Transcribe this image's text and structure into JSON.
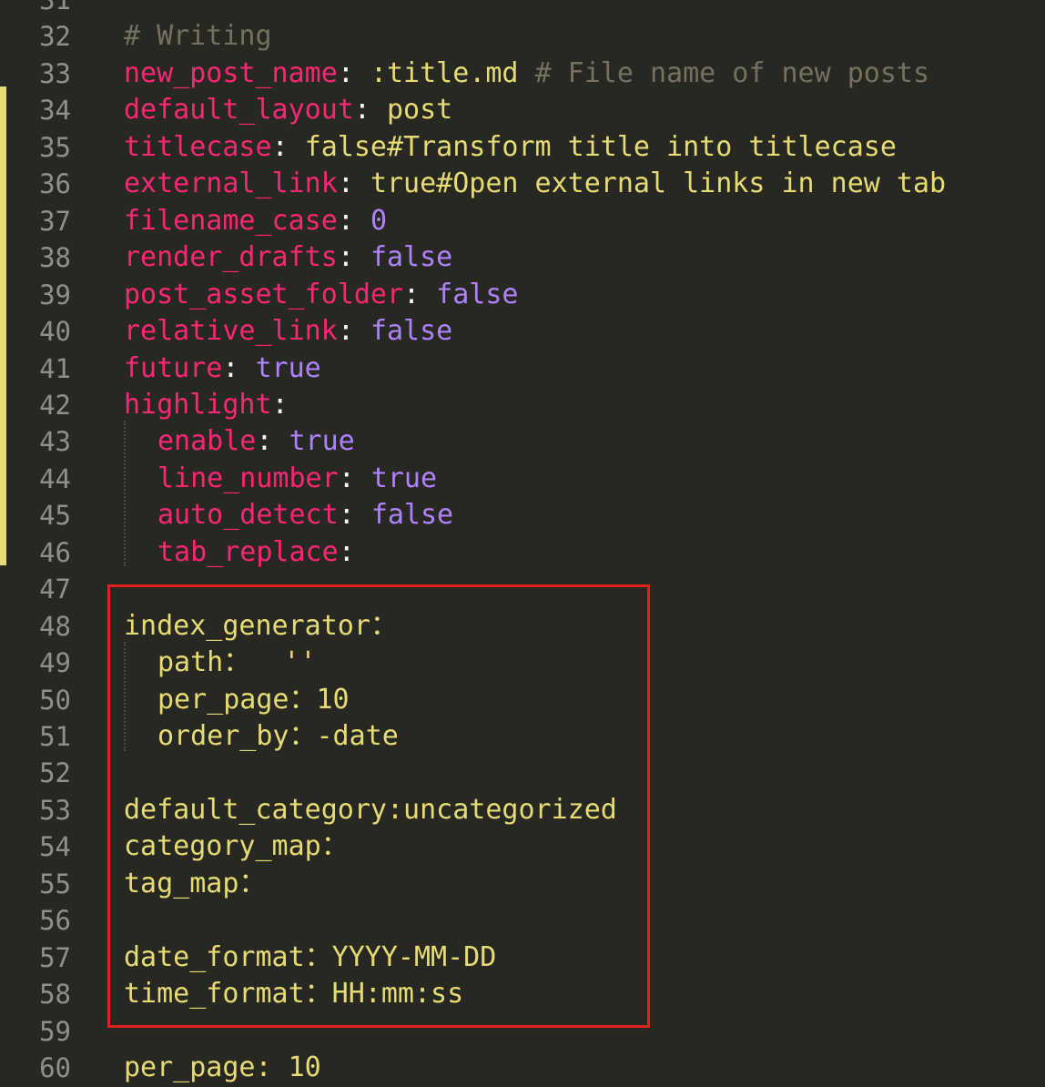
{
  "editor": {
    "lines": [
      {
        "n": "31",
        "parts": []
      },
      {
        "n": "32",
        "parts": [
          {
            "t": "# Writing",
            "c": "c"
          }
        ]
      },
      {
        "n": "33",
        "parts": [
          {
            "t": "new_post_name",
            "c": "k"
          },
          {
            "t": ": ",
            "c": "p"
          },
          {
            "t": ":title.md ",
            "c": "s"
          },
          {
            "t": "# File name of new posts",
            "c": "c"
          }
        ]
      },
      {
        "n": "34",
        "parts": [
          {
            "t": "default_layout",
            "c": "k"
          },
          {
            "t": ": ",
            "c": "p"
          },
          {
            "t": "post",
            "c": "s"
          }
        ]
      },
      {
        "n": "35",
        "parts": [
          {
            "t": "titlecase",
            "c": "k"
          },
          {
            "t": ": ",
            "c": "p"
          },
          {
            "t": "false#Transform title into titlecase",
            "c": "s"
          }
        ]
      },
      {
        "n": "36",
        "parts": [
          {
            "t": "external_link",
            "c": "k"
          },
          {
            "t": ": ",
            "c": "p"
          },
          {
            "t": "true#Open external links in new tab",
            "c": "s"
          }
        ]
      },
      {
        "n": "37",
        "parts": [
          {
            "t": "filename_case",
            "c": "k"
          },
          {
            "t": ": ",
            "c": "p"
          },
          {
            "t": "0",
            "c": "b"
          }
        ]
      },
      {
        "n": "38",
        "parts": [
          {
            "t": "render_drafts",
            "c": "k"
          },
          {
            "t": ": ",
            "c": "p"
          },
          {
            "t": "false",
            "c": "b"
          }
        ]
      },
      {
        "n": "39",
        "parts": [
          {
            "t": "post_asset_folder",
            "c": "k"
          },
          {
            "t": ": ",
            "c": "p"
          },
          {
            "t": "false",
            "c": "b"
          }
        ]
      },
      {
        "n": "40",
        "parts": [
          {
            "t": "relative_link",
            "c": "k"
          },
          {
            "t": ": ",
            "c": "p"
          },
          {
            "t": "false",
            "c": "b"
          }
        ]
      },
      {
        "n": "41",
        "parts": [
          {
            "t": "future",
            "c": "k"
          },
          {
            "t": ": ",
            "c": "p"
          },
          {
            "t": "true",
            "c": "b"
          }
        ]
      },
      {
        "n": "42",
        "parts": [
          {
            "t": "highlight",
            "c": "k"
          },
          {
            "t": ":",
            "c": "p"
          }
        ]
      },
      {
        "n": "43",
        "indent": true,
        "parts": [
          {
            "t": "enable",
            "c": "k"
          },
          {
            "t": ": ",
            "c": "p"
          },
          {
            "t": "true",
            "c": "b"
          }
        ]
      },
      {
        "n": "44",
        "indent": true,
        "parts": [
          {
            "t": "line_number",
            "c": "k"
          },
          {
            "t": ": ",
            "c": "p"
          },
          {
            "t": "true",
            "c": "b"
          }
        ]
      },
      {
        "n": "45",
        "indent": true,
        "parts": [
          {
            "t": "auto_detect",
            "c": "k"
          },
          {
            "t": ": ",
            "c": "p"
          },
          {
            "t": "false",
            "c": "b"
          }
        ]
      },
      {
        "n": "46",
        "indent": true,
        "parts": [
          {
            "t": "tab_replace",
            "c": "k"
          },
          {
            "t": ":",
            "c": "p"
          }
        ]
      },
      {
        "n": "47",
        "parts": []
      },
      {
        "n": "48",
        "parts": [
          {
            "t": "index_generator：",
            "c": "y"
          }
        ]
      },
      {
        "n": "49",
        "indent": true,
        "parts": [
          {
            "t": "path：  ''",
            "c": "y"
          }
        ]
      },
      {
        "n": "50",
        "indent": true,
        "parts": [
          {
            "t": "per_page：10",
            "c": "y"
          }
        ]
      },
      {
        "n": "51",
        "indent": true,
        "parts": [
          {
            "t": "order_by：-date",
            "c": "y"
          }
        ]
      },
      {
        "n": "52",
        "parts": []
      },
      {
        "n": "53",
        "parts": [
          {
            "t": "default_category:uncategorized",
            "c": "y"
          }
        ]
      },
      {
        "n": "54",
        "parts": [
          {
            "t": "category_map：",
            "c": "y"
          }
        ]
      },
      {
        "n": "55",
        "parts": [
          {
            "t": "tag_map：",
            "c": "y"
          }
        ]
      },
      {
        "n": "56",
        "parts": []
      },
      {
        "n": "57",
        "parts": [
          {
            "t": "date_format：YYYY-MM-DD",
            "c": "y"
          }
        ]
      },
      {
        "n": "58",
        "parts": [
          {
            "t": "time_format：HH:mm:ss",
            "c": "y"
          }
        ]
      },
      {
        "n": "59",
        "parts": []
      },
      {
        "n": "60",
        "parts": [
          {
            "t": "per_page: 10",
            "c": "y"
          }
        ]
      }
    ]
  },
  "colors": {
    "background": "#272822",
    "line_number": "#90908a",
    "key": "#f92672",
    "string": "#e6db74",
    "comment": "#75715e",
    "constant": "#ae81ff",
    "modified_marker": "#e6db74",
    "highlight_box": "#e02020"
  }
}
